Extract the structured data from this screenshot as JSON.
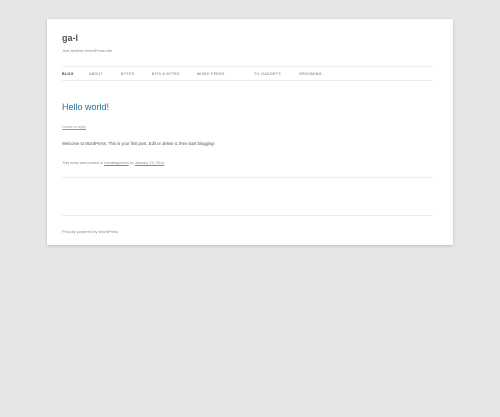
{
  "header": {
    "site_title": "ga-l",
    "site_description": "Just another WordPress site"
  },
  "nav": {
    "items": [
      {
        "label": "Blog"
      },
      {
        "label": "About"
      },
      {
        "label": "Bytes"
      },
      {
        "label": "Bits & Bytes"
      },
      {
        "label": "Mixed Feeds"
      },
      {
        "label": "Til Gadgets"
      },
      {
        "label": "Grooming"
      }
    ]
  },
  "post": {
    "title": "Hello world!",
    "meta_top": "Leave a reply",
    "content": "Welcome to WordPress. This is your first post. Edit or delete it, then start blogging!",
    "footer_prefix": "This entry was posted in",
    "category": "Uncategorized",
    "footer_mid": "on",
    "date": "January 13, 2014",
    "footer_suffix": "."
  },
  "footer": {
    "credit": "Proudly powered by WordPress"
  }
}
